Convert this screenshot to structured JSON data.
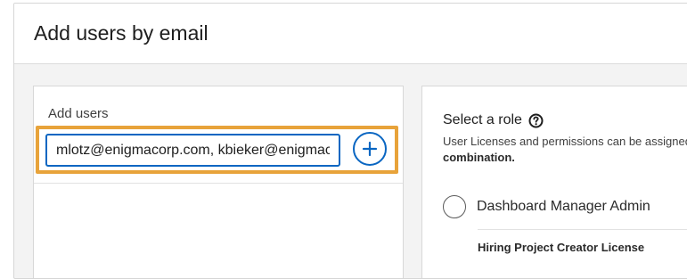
{
  "dialog": {
    "title": "Add users by email"
  },
  "users_panel": {
    "label": "Add users",
    "input_value": "mlotz@enigmacorp.com, kbieker@enigmacorp.com",
    "add_button_icon": "plus-circle-icon"
  },
  "role_panel": {
    "heading": "Select a role",
    "help_icon": "question-circle-icon",
    "description_line1": "User Licenses and permissions can be assigned in any",
    "description_line2": "combination.",
    "option_label": "Dashboard Manager Admin",
    "license_label": "Hiring Project Creator License"
  },
  "colors": {
    "accent": "#0a66c2",
    "highlight": "#e8a33a"
  }
}
